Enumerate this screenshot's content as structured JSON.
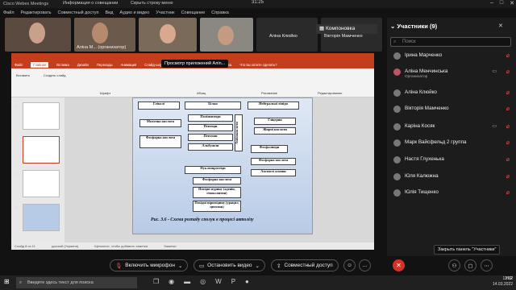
{
  "window": {
    "title": "Cisco Webex Meetings",
    "time": "31:25"
  },
  "menu": [
    "Файл",
    "Редактировать",
    "Совместный доступ",
    "Вид",
    "Аудио и видео",
    "Участник",
    "Совещание",
    "Справка"
  ],
  "menu_info": "Информация о совещании",
  "menu_hide": "Скрыть строку меню",
  "tiles": [
    {
      "name": ""
    },
    {
      "name": "Аліна М... (организатор)"
    },
    {
      "name": ""
    },
    {
      "name": ""
    },
    {
      "name": "Аліна Клюйко"
    },
    {
      "name": "Вікторія Мамченко"
    }
  ],
  "layout_button": "Компоновка",
  "tooltip": "Просмотр приложений Аліn...",
  "ppt": {
    "tabs": [
      "Файл",
      "Главная",
      "Вставка",
      "Дизайн",
      "Переходы",
      "Анимация",
      "Слайд-шоу",
      "Рецензирование",
      "Вид",
      "Справка",
      "Что вы хотите сделать?"
    ],
    "active_tab": "Главная",
    "ribbon": [
      "Вставить",
      "Создать слайд",
      "Шрифт",
      "Абзац",
      "Рисование",
      "Редактирование"
    ],
    "status_left": "Слайд 8 из 11",
    "status_lang": "русский (Украина)",
    "status_notes": "Заметки",
    "status_zoom": "Щелкните, чтобы добавить заметки",
    "slide_numbers": [
      "8",
      "9",
      "10",
      "11"
    ]
  },
  "slide": {
    "boxes": [
      {
        "id": "b1",
        "text": "Гліколі"
      },
      {
        "id": "b2",
        "text": "Молочна кислота"
      },
      {
        "id": "b3",
        "text": "Фосфорна кислота"
      },
      {
        "id": "b4",
        "text": "Білки"
      },
      {
        "id": "b5",
        "text": "Поліпептиди"
      },
      {
        "id": "b6",
        "text": "Пептиди"
      },
      {
        "id": "b7",
        "text": "Пептони"
      },
      {
        "id": "b8",
        "text": "Альбумози"
      },
      {
        "id": "b9",
        "text": "Амінокислоти"
      },
      {
        "id": "b10",
        "text": "Нейтральні ліпіди"
      },
      {
        "id": "b11",
        "text": "Гліцерин"
      },
      {
        "id": "b12",
        "text": "Жирні кислоти"
      },
      {
        "id": "b13",
        "text": "Фосфоліпіди"
      },
      {
        "id": "b14",
        "text": "Фосфорна кислота"
      },
      {
        "id": "b15",
        "text": "Азотисті основи"
      },
      {
        "id": "b16",
        "text": "Нуклеопротеїди"
      },
      {
        "id": "b17",
        "text": "Фосфорна кислота"
      },
      {
        "id": "b18",
        "text": "Похідні пурину (аденін, гіпоксантин)"
      },
      {
        "id": "b19",
        "text": "Похідні піримідину (урацил, цитозин)"
      }
    ],
    "caption": "Рис. 3.6 - Схема розпаду сполук в процесі автолізу"
  },
  "panel": {
    "title": "Участники (9)",
    "search_placeholder": "Поиск",
    "participants": [
      {
        "name": "Ірина Марченко",
        "role": ""
      },
      {
        "name": "Аліна Менчинська",
        "role": "Организатор"
      },
      {
        "name": "Аліна Клюйко",
        "role": ""
      },
      {
        "name": "Вікторія Мамченко",
        "role": ""
      },
      {
        "name": "Каріна Косяк",
        "role": ""
      },
      {
        "name": "Марк Вайсфельд 2 группа",
        "role": ""
      },
      {
        "name": "Настя Глухенька",
        "role": ""
      },
      {
        "name": "Юля Калюжна",
        "role": ""
      },
      {
        "name": "Юлія Тищенко",
        "role": ""
      }
    ],
    "close_tip": "Закрыть панель \"Участники\""
  },
  "controls": {
    "mic": "Включить микрофон",
    "video": "Остановить видео",
    "share": "Совместный доступ"
  },
  "taskbar": {
    "search": "Введите здесь текст для поиска",
    "lang": "УКР",
    "clock_time": "12:12",
    "clock_date": "14.03.2022"
  },
  "colors": {
    "ppt_accent": "#c43e1c",
    "end_call": "#d93025",
    "mute": "#e54"
  }
}
